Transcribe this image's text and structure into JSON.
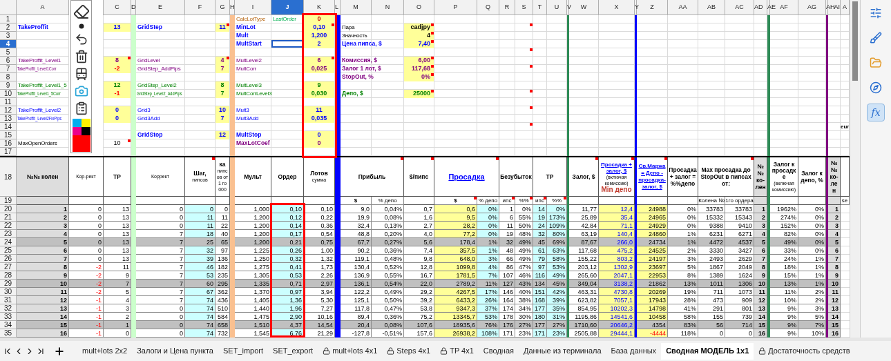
{
  "columns": {
    "A": {
      "letter": "A",
      "selected": false
    },
    "C": {
      "letter": "C",
      "selected": false
    },
    "D": {
      "letter": "D",
      "selected": false
    },
    "E": {
      "letter": "E",
      "selected": false
    },
    "F": {
      "letter": "F",
      "selected": false
    },
    "G": {
      "letter": "G",
      "selected": false
    },
    "H": {
      "letter": "H",
      "selected": false
    },
    "I": {
      "letter": "I",
      "selected": false
    },
    "J": {
      "letter": "J",
      "selected": true
    },
    "K": {
      "letter": "K",
      "selected": false
    },
    "L": {
      "letter": "L",
      "selected": false
    },
    "M": {
      "letter": "M",
      "selected": false
    },
    "N": {
      "letter": "N",
      "selected": false
    },
    "O": {
      "letter": "O",
      "selected": false
    },
    "P": {
      "letter": "P",
      "selected": false
    },
    "Q": {
      "letter": "Q",
      "selected": false
    },
    "R": {
      "letter": "R",
      "selected": false
    },
    "S": {
      "letter": "S",
      "selected": false
    },
    "T": {
      "letter": "T",
      "selected": false
    },
    "U": {
      "letter": "U",
      "selected": false
    },
    "V": {
      "letter": "V",
      "selected": false
    },
    "W": {
      "letter": "W",
      "selected": false
    },
    "X": {
      "letter": "X",
      "selected": false
    },
    "Y": {
      "letter": "Y",
      "selected": false
    },
    "Z": {
      "letter": "Z",
      "selected": false
    },
    "AA": {
      "letter": "AA",
      "selected": false
    },
    "AB": {
      "letter": "AB",
      "selected": false
    },
    "AC": {
      "letter": "AC",
      "selected": false
    },
    "AD": {
      "letter": "AD",
      "selected": false
    },
    "AE": {
      "letter": "AE",
      "selected": false
    },
    "AF": {
      "letter": "AF",
      "selected": false
    },
    "AG": {
      "letter": "AG",
      "selected": false
    },
    "AH": {
      "letter": "AH",
      "selected": false
    },
    "AI": {
      "letter": "AI",
      "selected": false
    },
    "AJ": {
      "letter": "A",
      "selected": false
    }
  },
  "top_rows": [
    {
      "row": "1",
      "selected": false,
      "cells": {
        "I": {
          "text": "CalcLotType",
          "kind": "label-calc"
        },
        "J": {
          "text": "LastOrder",
          "kind": "label-last"
        },
        "K": {
          "text": "0",
          "kind": "value-initial"
        }
      }
    },
    {
      "row": "2",
      "selected": false,
      "cells": {
        "A": {
          "text": "TakeProffit",
          "kind": "heading-main"
        },
        "C": {
          "text": "13",
          "kind": "value-main"
        },
        "E": {
          "text": "GridStep",
          "kind": "heading-main"
        },
        "G": {
          "text": "11",
          "kind": "value-main",
          "note": true
        },
        "I": {
          "text": "MinLot",
          "kind": "heading-main"
        },
        "K": {
          "text": "0,10",
          "kind": "value-main",
          "note": true
        },
        "M": {
          "text": "Пара",
          "kind": "label-neutral"
        },
        "O": {
          "text": "cadjpy",
          "kind": "number-neutral",
          "note": true
        },
        "S": {
          "note": true
        }
      }
    },
    {
      "row": "3",
      "selected": false,
      "cells": {
        "I": {
          "text": "Mult",
          "kind": "heading-main"
        },
        "K": {
          "text": "1,200",
          "kind": "value-main"
        },
        "M": {
          "text": "Значность",
          "kind": "label-neutral"
        },
        "O": {
          "text": "4",
          "kind": "number-neutral",
          "note": true
        }
      }
    },
    {
      "row": "4",
      "selected": true,
      "cells": {
        "I": {
          "text": "MultStart",
          "kind": "heading-main"
        },
        "K": {
          "text": "2",
          "kind": "value-main"
        },
        "M": {
          "text": "Цена пипса, $",
          "kind": "heading-main"
        },
        "O": {
          "text": "7,40",
          "kind": "number-main",
          "note": true
        }
      }
    },
    {
      "row": "5",
      "selected": false,
      "cells": {
        "S": {
          "note": true
        }
      }
    },
    {
      "row": "6",
      "selected": false,
      "cells": {
        "A": {
          "text": "TakeProffit_Level1",
          "kind": "label-level1"
        },
        "C": {
          "text": "8",
          "kind": "value-level1",
          "note": true
        },
        "E": {
          "text": "GridLevel",
          "kind": "label-level1"
        },
        "G": {
          "text": "4",
          "kind": "value-level1",
          "note": true
        },
        "I": {
          "text": "MultLevel2",
          "kind": "label-level1"
        },
        "K": {
          "text": "6",
          "kind": "value-level1",
          "note": true
        },
        "M": {
          "text": "Комиссия, $",
          "kind": "heading-level1"
        },
        "O": {
          "text": "6,00",
          "kind": "number-level1",
          "note": true
        }
      }
    },
    {
      "row": "7",
      "selected": false,
      "cells": {
        "A": {
          "text": "TakeProffit_Level1Corr",
          "kind": "small-level1"
        },
        "C": {
          "text": "-2",
          "kind": "value-negative"
        },
        "E": {
          "text": "GridStep_AddPips",
          "kind": "label-level1"
        },
        "G": {
          "text": "7",
          "kind": "value-level1"
        },
        "I": {
          "text": "MultCorr",
          "kind": "label-level1"
        },
        "K": {
          "text": "0,025",
          "kind": "value-level1"
        },
        "M": {
          "text": "Залог 1 лот, $",
          "kind": "heading-level1"
        },
        "O": {
          "text": "117,68",
          "kind": "number-level1",
          "note": true
        },
        "S": {
          "note": true
        }
      }
    },
    {
      "row": "8",
      "selected": false,
      "cells": {
        "M": {
          "text": "StopOut, %",
          "kind": "heading-level1"
        },
        "O": {
          "text": "0%",
          "kind": "number-level1",
          "note": true
        }
      }
    },
    {
      "row": "9",
      "selected": false,
      "cells": {
        "A": {
          "text": "TakeProffit_Level1_5",
          "kind": "label-level15"
        },
        "C": {
          "text": "12",
          "kind": "value-level15"
        },
        "E": {
          "text": "GridStep_Level2",
          "kind": "label-level15"
        },
        "G": {
          "text": "8",
          "kind": "value-level15"
        },
        "I": {
          "text": "MultLevel3",
          "kind": "label-level15"
        },
        "K": {
          "text": "9",
          "kind": "value-level15"
        }
      }
    },
    {
      "row": "10",
      "selected": false,
      "cells": {
        "A": {
          "text": "TakeProffit_Level1_5Corr",
          "kind": "small-level15"
        },
        "C": {
          "text": "-1",
          "kind": "value-negative"
        },
        "E": {
          "text": "GridStep_Level2_AddPips",
          "kind": "small-level15"
        },
        "G": {
          "text": "7",
          "kind": "value-level15"
        },
        "I": {
          "text": "MultCorrLevel3",
          "kind": "label-level15"
        },
        "K": {
          "text": "0,030",
          "kind": "value-level15"
        },
        "M": {
          "text": "Депо, $",
          "kind": "heading-level15"
        },
        "O": {
          "text": "25000",
          "kind": "number-level15",
          "note": true
        },
        "S": {
          "note": true
        }
      }
    },
    {
      "row": "11",
      "selected": false
    },
    {
      "row": "12",
      "selected": false,
      "cells": {
        "A": {
          "text": "TakeProffit_Level2",
          "kind": "label-main"
        },
        "C": {
          "text": "0",
          "kind": "value-main"
        },
        "E": {
          "text": "Grid3",
          "kind": "label-main"
        },
        "G": {
          "text": "10",
          "kind": "value-main"
        },
        "I": {
          "text": "Mult3",
          "kind": "label-main"
        },
        "K": {
          "text": "11",
          "kind": "value-main"
        },
        "S": {
          "note": true
        }
      }
    },
    {
      "row": "13",
      "selected": false,
      "cells": {
        "A": {
          "text": "TakeProffit_Level2FixPips",
          "kind": "small-main"
        },
        "C": {
          "text": "0",
          "kind": "value-main"
        },
        "E": {
          "text": "Grid3Add",
          "kind": "label-main"
        },
        "G": {
          "text": "7",
          "kind": "value-main"
        },
        "I": {
          "text": "Mult3Add",
          "kind": "label-main"
        },
        "K": {
          "text": "0,035",
          "kind": "value-main"
        }
      }
    },
    {
      "row": "14",
      "selected": false,
      "cells": {
        "S": {
          "note": true
        },
        "AJ": {
          "text": "eur",
          "kind": "edge-neutral"
        }
      }
    },
    {
      "row": "15",
      "selected": false,
      "cells": {
        "E": {
          "text": "GridStop",
          "kind": "heading-main"
        },
        "G": {
          "text": "12",
          "kind": "value-main"
        },
        "I": {
          "text": "MultStop",
          "kind": "heading-main"
        },
        "K": {
          "text": "0",
          "kind": "value-main"
        }
      }
    },
    {
      "row": "16",
      "selected": false,
      "cells": {
        "A": {
          "text": "MaxOpenOrders",
          "kind": "label-neutral"
        },
        "C": {
          "text": "10",
          "kind": "count-neutral",
          "note": true
        },
        "I": {
          "text": "MaxLotCoef",
          "kind": "heading-level1"
        },
        "K": {
          "text": "0",
          "kind": "value-level1"
        }
      }
    },
    {
      "row": "17",
      "selected": false
    }
  ],
  "table": {
    "header": {
      "row": "18",
      "selected": false,
      "cells": {
        "A": {
          "parts": [
            {
              "kind": "title",
              "text": "№№ колен"
            }
          ]
        },
        "B": {
          "parts": [
            {
              "kind": "note",
              "text": "Кор-рект"
            }
          ]
        },
        "C": {
          "parts": [
            {
              "kind": "title",
              "text": "TP"
            }
          ]
        },
        "E": {
          "parts": [
            {
              "kind": "note",
              "text": "Коррект"
            }
          ]
        },
        "F": {
          "parts": [
            {
              "kind": "title",
              "text": "Шаг,"
            },
            {
              "kind": "note",
              "text": "пипсов"
            }
          ],
          "note": true
        },
        "G": {
          "parts": [
            {
              "kind": "title",
              "text": "ка"
            },
            {
              "kind": "note",
              "text": "пипсов от 1 го 000"
            }
          ]
        },
        "I": {
          "parts": [
            {
              "kind": "title",
              "text": "Мульт"
            }
          ]
        },
        "J": {
          "parts": [
            {
              "kind": "title",
              "text": "Ордер"
            }
          ]
        },
        "K": {
          "parts": [
            {
              "kind": "title",
              "text": "Лотов"
            },
            {
              "kind": "note",
              "text": "сумма"
            }
          ]
        },
        "M": {
          "parts": [
            {
              "kind": "title",
              "text": "Прибыль"
            }
          ],
          "note": true
        },
        "O": {
          "parts": [
            {
              "kind": "title",
              "text": "$/пипс"
            }
          ],
          "note": true
        },
        "P": {
          "parts": [
            {
              "kind": "big",
              "text": "Просадка"
            }
          ],
          "note": true
        },
        "R": {
          "parts": [
            {
              "kind": "title",
              "text": "Безубыток"
            }
          ]
        },
        "T": {
          "parts": [
            {
              "kind": "title",
              "text": "TP"
            }
          ]
        },
        "W": {
          "parts": [
            {
              "kind": "title",
              "text": "Залог, $"
            }
          ],
          "note": true
        },
        "X": {
          "parts": [
            {
              "kind": "blue",
              "text": "Просадка + залог, $"
            },
            {
              "kind": "note",
              "text": "(включая комиссию)"
            },
            {
              "kind": "alert",
              "text": "Min депо"
            }
          ],
          "note": true
        },
        "Z": {
          "parts": [
            {
              "kind": "blue",
              "text": "Св.Маржа = Депо - просадка-залог, $"
            }
          ],
          "note": true
        },
        "AA": {
          "parts": [
            {
              "kind": "title",
              "text": "Просадка + залог = %%депо"
            }
          ]
        },
        "AB": {
          "parts": [
            {
              "kind": "title",
              "text": "Max просадка до StopOut в пипсах от:"
            }
          ],
          "note": true
        },
        "AD": {
          "parts": [
            {
              "kind": "title",
              "text": "№№ ко-лен"
            }
          ]
        },
        "AF": {
          "parts": [
            {
              "kind": "title",
              "text": "Залог к просадке"
            },
            {
              "kind": "note",
              "text": "(включая комиссию)"
            }
          ]
        },
        "AG": {
          "parts": [
            {
              "kind": "title",
              "text": "Залог к депо, %"
            }
          ]
        },
        "AI": {
          "parts": [
            {
              "kind": "title",
              "text": "№№ ко-лен"
            }
          ]
        }
      }
    },
    "subheader": {
      "row": "19",
      "selected": false,
      "cells": {
        "M": {
          "text": "$"
        },
        "N": {
          "text": "% депо"
        },
        "P": {
          "text": "$",
          "note": true
        },
        "Q": {
          "text": "% депо"
        },
        "R": {
          "text": "ипс",
          "note": true
        },
        "S": {
          "text": "%%",
          "note": true
        },
        "T": {
          "text": "ипс",
          "note": true
        },
        "U": {
          "text": "%%",
          "note": true
        },
        "AB": {
          "text": "Колена №"
        },
        "AC": {
          "text": "1го ордера"
        },
        "AJ": {
          "text": "se"
        }
      }
    },
    "rows": [
      {
        "row": "20",
        "selected": false,
        "shaded": false,
        "cells": [
          "1",
          "0",
          "13",
          "0",
          "0",
          "0",
          "1,000",
          "0,10",
          "0,10",
          "9,0",
          "0,04%",
          "0,7",
          "0,6",
          "0%",
          "1",
          "0%",
          "14",
          "0%",
          "11,77",
          "12,4",
          "24988",
          "0%",
          "33783",
          "33783",
          "1",
          "1962%",
          "0%",
          "1"
        ]
      },
      {
        "row": "21",
        "selected": false,
        "shaded": false,
        "cells": [
          "2",
          "0",
          "13",
          "0",
          "11",
          "11",
          "1,200",
          "0,12",
          "0,22",
          "19,9",
          "0,08%",
          "1,6",
          "9,5",
          "0%",
          "6",
          "55%",
          "19",
          "173%",
          "25,89",
          "35,4",
          "24965",
          "0%",
          "15332",
          "15343",
          "2",
          "274%",
          "0%",
          "2"
        ]
      },
      {
        "row": "22",
        "selected": false,
        "shaded": false,
        "cells": [
          "3",
          "0",
          "13",
          "0",
          "11",
          "22",
          "1,200",
          "0,14",
          "0,36",
          "32,4",
          "0,13%",
          "2,7",
          "28,2",
          "0%",
          "11",
          "50%",
          "24",
          "109%",
          "42,84",
          "71,1",
          "24929",
          "0%",
          "9388",
          "9410",
          "3",
          "152%",
          "0%",
          "3"
        ]
      },
      {
        "row": "23",
        "selected": false,
        "shaded": false,
        "cells": [
          "4",
          "0",
          "13",
          "7",
          "18",
          "40",
          "1,200",
          "0,17",
          "0,54",
          "48,8",
          "0,20%",
          "4,0",
          "77,2",
          "0%",
          "19",
          "48%",
          "32",
          "80%",
          "63,19",
          "140,4",
          "24860",
          "1%",
          "6231",
          "6271",
          "4",
          "82%",
          "0%",
          "4"
        ]
      },
      {
        "row": "24",
        "selected": false,
        "shaded": true,
        "cells": [
          "5",
          "0",
          "13",
          "7",
          "25",
          "65",
          "1,200",
          "0,21",
          "0,75",
          "67,7",
          "0,27%",
          "5,6",
          "178,4",
          "1%",
          "32",
          "49%",
          "45",
          "69%",
          "87,67",
          "266,0",
          "24734",
          "1%",
          "4472",
          "4537",
          "5",
          "49%",
          "0%",
          "5"
        ]
      },
      {
        "row": "25",
        "selected": false,
        "shaded": false,
        "cells": [
          "6",
          "0",
          "13",
          "7",
          "32",
          "97",
          "1,225",
          "0,26",
          "1,00",
          "90,2",
          "0,36%",
          "7,4",
          "357,5",
          "1%",
          "48",
          "49%",
          "61",
          "63%",
          "117,68",
          "475,2",
          "24525",
          "2%",
          "3330",
          "3427",
          "6",
          "33%",
          "0%",
          "6"
        ]
      },
      {
        "row": "26",
        "selected": false,
        "shaded": false,
        "cells": [
          "7",
          "0",
          "13",
          "7",
          "39",
          "136",
          "1,250",
          "0,32",
          "1,32",
          "119,1",
          "0,48%",
          "9,8",
          "648,0",
          "3%",
          "66",
          "49%",
          "79",
          "58%",
          "155,22",
          "803,2",
          "24197",
          "3%",
          "2493",
          "2629",
          "7",
          "24%",
          "1%",
          "7"
        ]
      },
      {
        "row": "27",
        "selected": false,
        "shaded": false,
        "cells": [
          "8",
          {
            "text": "-2",
            "alert": true
          },
          "11",
          "7",
          "46",
          "182",
          "1,275",
          "0,41",
          "1,73",
          "130,4",
          "0,52%",
          "12,8",
          "1099,8",
          "4%",
          "86",
          "47%",
          "97",
          "53%",
          "203,12",
          "1302,9",
          "23697",
          "5%",
          "1867",
          "2049",
          "8",
          "18%",
          "1%",
          "8"
        ]
      },
      {
        "row": "28",
        "selected": false,
        "shaded": false,
        "cells": [
          "9",
          {
            "text": "-2",
            "alert": true
          },
          "9",
          "7",
          "53",
          "235",
          "1,305",
          "0,53",
          "2,26",
          "136,9",
          "0,55%",
          "16,7",
          "1781,5",
          "7%",
          "107",
          "46%",
          "116",
          "49%",
          "265,60",
          "2047,1",
          "22953",
          "8%",
          "1389",
          "1624",
          "9",
          "15%",
          "1%",
          "9"
        ]
      },
      {
        "row": "29",
        "selected": false,
        "shaded": true,
        "cells": [
          "10",
          {
            "text": "-2",
            "alert": true
          },
          "7",
          "7",
          "60",
          "295",
          "1,335",
          "0,71",
          "2,97",
          "136,1",
          "0,54%",
          "22,0",
          "2789,2",
          "11%",
          "127",
          "43%",
          "134",
          "45%",
          "349,04",
          "3138,2",
          "21862",
          "13%",
          "1011",
          "1306",
          "10",
          "13%",
          "1%",
          "10"
        ]
      },
      {
        "row": "30",
        "selected": false,
        "shaded": false,
        "cells": [
          "11",
          {
            "text": "-2",
            "alert": true
          },
          "5",
          "7",
          "67",
          "362",
          "1,370",
          "0,97",
          "3,94",
          "122,2",
          "0,49%",
          "29,2",
          "4267,5",
          "17%",
          "146",
          "40%",
          "151",
          "42%",
          "463,31",
          "4730,8",
          "20269",
          "19%",
          "711",
          "1073",
          "11",
          "11%",
          "2%",
          "11"
        ]
      },
      {
        "row": "31",
        "selected": false,
        "shaded": false,
        "cells": [
          "12",
          {
            "text": "-1",
            "alert": true
          },
          "4",
          "7",
          "74",
          "436",
          "1,405",
          "1,36",
          "5,30",
          "125,1",
          "0,50%",
          "39,2",
          "6433,2",
          "26%",
          "164",
          "38%",
          "168",
          "39%",
          "623,82",
          "7057,1",
          "17943",
          "28%",
          "473",
          "909",
          "12",
          "10%",
          "2%",
          "12"
        ]
      },
      {
        "row": "32",
        "selected": false,
        "shaded": false,
        "cells": [
          "13",
          {
            "text": "-1",
            "alert": true
          },
          "3",
          "0",
          "74",
          "510",
          "1,440",
          "1,96",
          "7,27",
          "117,8",
          "0,47%",
          "53,8",
          "9347,3",
          "37%",
          "174",
          "34%",
          "177",
          "35%",
          "854,95",
          "10202,3",
          "14798",
          "41%",
          "291",
          "801",
          "13",
          "9%",
          "3%",
          "13"
        ]
      },
      {
        "row": "33",
        "selected": false,
        "shaded": false,
        "cells": [
          "14",
          {
            "text": "-1",
            "alert": true
          },
          "2",
          "0",
          "74",
          "584",
          "1,475",
          "2,90",
          "10,16",
          "89,4",
          "0,36%",
          "75,2",
          "13345,7",
          "53%",
          "178",
          "30%",
          "180",
          "31%",
          "1195,86",
          "14541,6",
          "10458",
          "58%",
          "155",
          "739",
          "14",
          "9%",
          "5%",
          "14"
        ]
      },
      {
        "row": "34",
        "selected": false,
        "shaded": true,
        "cells": [
          "15",
          {
            "text": "-1",
            "alert": true
          },
          "1",
          "0",
          "74",
          "658",
          "1,510",
          "4,37",
          "14,54",
          "20,4",
          "0,08%",
          "107,6",
          "18935,6",
          "76%",
          "176",
          "27%",
          "177",
          "27%",
          "1710,60",
          "20646,2",
          "4354",
          "83%",
          "56",
          "714",
          "15",
          "9%",
          "7%",
          "15"
        ]
      },
      {
        "row": "35",
        "selected": false,
        "shaded": false,
        "cells": [
          "16",
          {
            "text": "-1",
            "alert": true
          },
          "0",
          "0",
          "74",
          "732",
          "1,545",
          "6,76",
          "21,29",
          "-127,8",
          "-0,51%",
          "157,6",
          "26938,2",
          "108%",
          "171",
          "23%",
          "171",
          "23%",
          "2505,88",
          "29444,1",
          {
            "text": "-4444",
            "alert": true
          },
          "118%",
          "0",
          "0",
          "16",
          "9%",
          "10%",
          "16"
        ]
      }
    ]
  },
  "sidebar": [
    {
      "kind": "properties",
      "selected": false
    },
    {
      "kind": "styles",
      "selected": false
    },
    {
      "kind": "gallery",
      "selected": false
    },
    {
      "kind": "navigator",
      "selected": false
    },
    {
      "kind": "functions",
      "label": "fx",
      "selected": true
    }
  ],
  "sheet_tabs": [
    {
      "label": "mult+lots 2x2",
      "locked": false,
      "selected": false
    },
    {
      "label": "Залоги и Цена пункта",
      "locked": false,
      "selected": false
    },
    {
      "label": "SET_import",
      "locked": false,
      "selected": false
    },
    {
      "label": "SET_export",
      "locked": false,
      "selected": false
    },
    {
      "label": "mult+lots 4x1",
      "locked": true,
      "selected": false
    },
    {
      "label": "Steps 4x1",
      "locked": true,
      "selected": false
    },
    {
      "label": "TP 4x1",
      "locked": true,
      "selected": false
    },
    {
      "label": "Сводная",
      "locked": false,
      "selected": false
    },
    {
      "label": "Данные из терминала",
      "locked": false,
      "selected": false
    },
    {
      "label": "База данных",
      "locked": false,
      "selected": false
    },
    {
      "label": "Сводная МОДЕЛЬ 1x1",
      "locked": false,
      "selected": true
    },
    {
      "label": "Достаточность средств",
      "locked": true,
      "selected": false
    }
  ]
}
